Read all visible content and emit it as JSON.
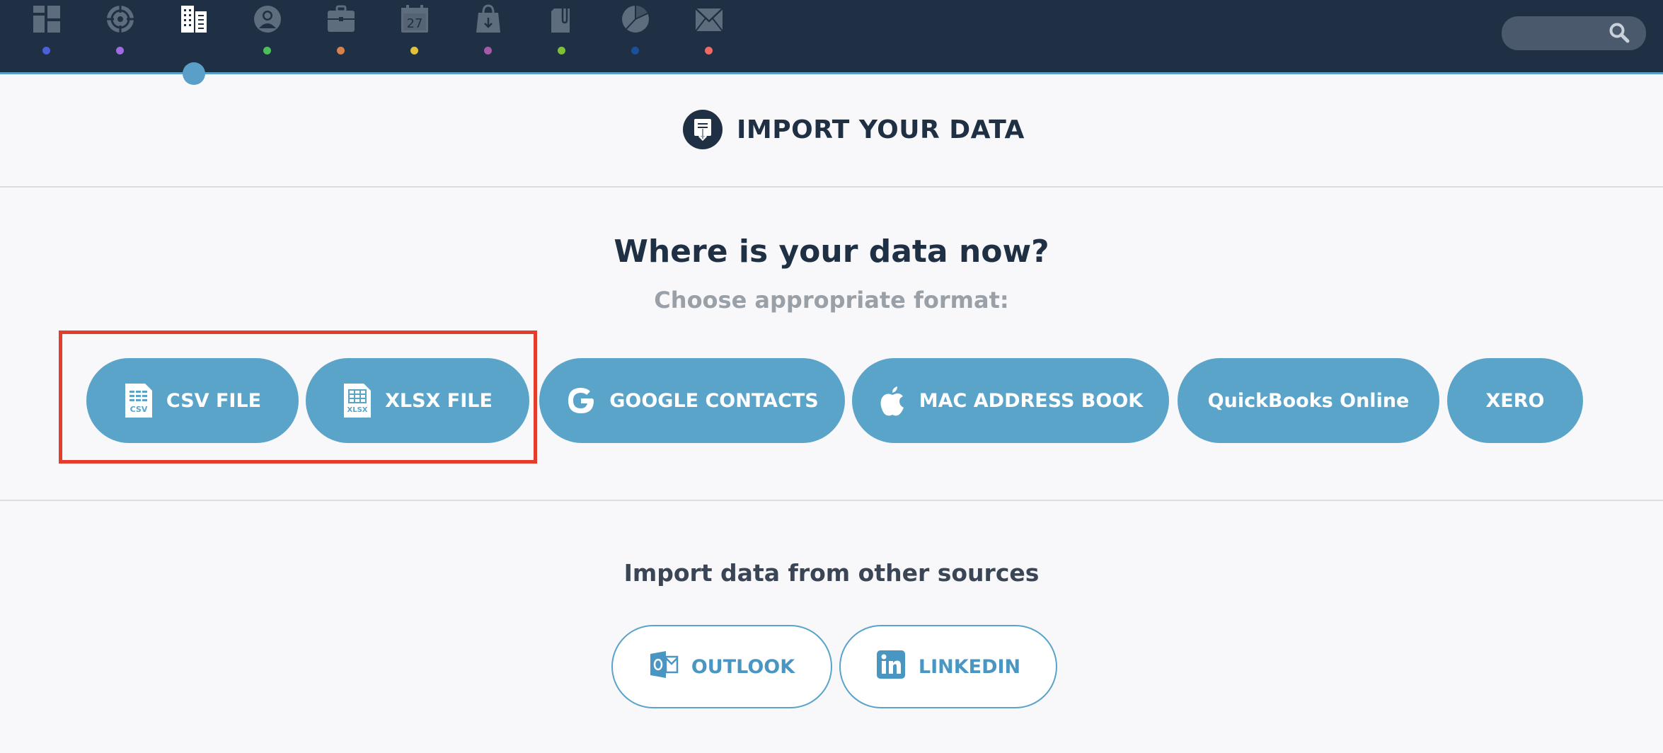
{
  "nav": {
    "items": [
      {
        "icon": "dashboard-icon",
        "dot_color": "#4a5fd8"
      },
      {
        "icon": "target-icon",
        "dot_color": "#a06be0"
      },
      {
        "icon": "buildings-icon",
        "dot_color": null,
        "active": true
      },
      {
        "icon": "contact-icon",
        "dot_color": "#4bbf5b"
      },
      {
        "icon": "briefcase-icon",
        "dot_color": "#d6824a"
      },
      {
        "icon": "calendar-icon",
        "dot_color": "#e0c23a",
        "label": "27"
      },
      {
        "icon": "shopping-bag-icon",
        "dot_color": "#a55aa8"
      },
      {
        "icon": "attachment-icon",
        "dot_color": "#7fbf3a"
      },
      {
        "icon": "pie-chart-icon",
        "dot_color": "#1c4f9a"
      },
      {
        "icon": "mail-icon",
        "dot_color": "#ee6a66"
      }
    ],
    "active_color": "#5a9fc7"
  },
  "search": {
    "placeholder": "",
    "icon": "search-icon"
  },
  "header": {
    "title": "IMPORT YOUR DATA",
    "icon": "import-document-icon"
  },
  "main": {
    "question": "Where is your data now?",
    "subtitle": "Choose appropriate format:",
    "formats": [
      {
        "label": "CSV FILE",
        "icon": "csv-file-icon",
        "icon_text": "CSV"
      },
      {
        "label": "XLSX FILE",
        "icon": "xlsx-file-icon",
        "icon_text": "XLSX"
      },
      {
        "label": "GOOGLE CONTACTS",
        "icon": "google-icon"
      },
      {
        "label": "MAC ADDRESS BOOK",
        "icon": "apple-icon"
      },
      {
        "label": "QuickBooks Online"
      },
      {
        "label": "XERO"
      }
    ],
    "highlight_color": "#e53d2c"
  },
  "other": {
    "title": "Import data from other sources",
    "sources": [
      {
        "label": "OUTLOOK",
        "icon": "outlook-icon"
      },
      {
        "label": "LINKEDIN",
        "icon": "linkedin-icon"
      }
    ]
  },
  "colors": {
    "topbar": "#1f3044",
    "accent": "#5aa3c9",
    "background": "#f8f8fa"
  }
}
